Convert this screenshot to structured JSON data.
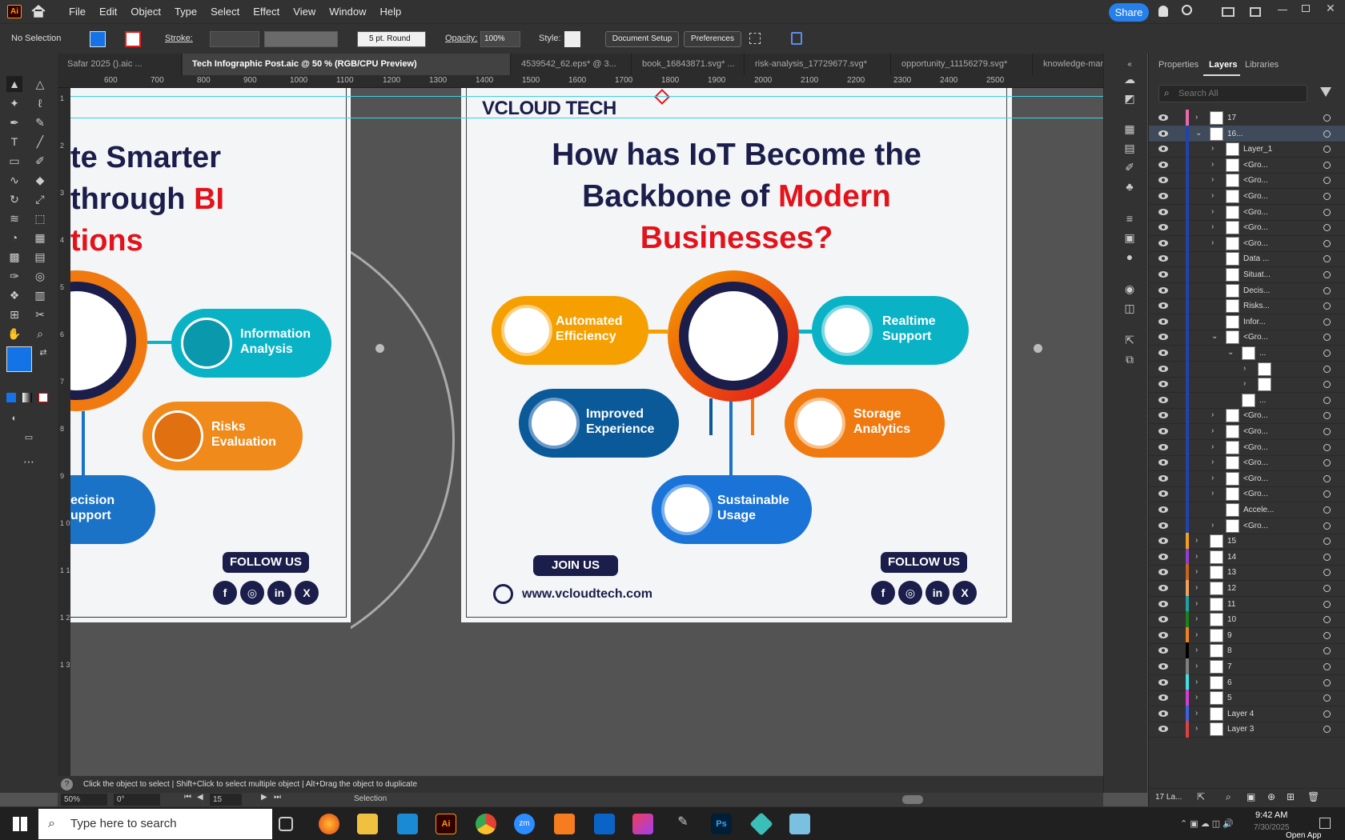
{
  "app": {
    "logo": "Ai",
    "menus": [
      "File",
      "Edit",
      "Object",
      "Type",
      "Select",
      "Effect",
      "View",
      "Window",
      "Help"
    ],
    "share": "Share"
  },
  "control": {
    "selection": "No Selection",
    "stroke_label": "Stroke:",
    "brush": "5 pt. Round",
    "opacity_label": "Opacity:",
    "opacity": "100%",
    "style_label": "Style:",
    "doc_setup": "Document Setup",
    "preferences": "Preferences"
  },
  "tabs": [
    "Safar 2025 ().aic ...",
    "Tech Infographic Post.aic @ 50 % (RGB/CPU Preview)",
    "4539542_62.eps* @ 3...",
    "book_16843871.svg* ...",
    "risk-analysis_17729677.svg*",
    "opportunity_11156279.svg*",
    "knowledge-manage"
  ],
  "ruler": {
    "top": [
      "600",
      "700",
      "800",
      "900",
      "1000",
      "1100",
      "1200",
      "1300",
      "1400",
      "1500",
      "1600",
      "1700",
      "1800",
      "1900",
      "2000",
      "2100",
      "2200",
      "2300",
      "2400",
      "2500"
    ],
    "left": [
      "1",
      "2",
      "3",
      "4",
      "5",
      "6",
      "7",
      "8",
      "9",
      "1 0",
      "1 1",
      "1 2",
      "1 3"
    ]
  },
  "poster_left": {
    "title1": "te Smarter",
    "title2a": "through ",
    "title2b": "BI",
    "title3": "tions",
    "pill1": "Information\nAnalysis",
    "pill2": "Risks\nEvaluation",
    "pill3": "ecision\nupport",
    "follow": "FOLLOW US"
  },
  "poster_right": {
    "logo": "VCLOUD TECH",
    "title1": "How has IoT Become the",
    "title2a": "Backbone of ",
    "title2b": "Modern",
    "title3": "Businesses?",
    "pills": [
      "Automated\nEfficiency",
      "Realtime\nSupport",
      "Improved\nExperience",
      "Storage\nAnalytics",
      "Sustainable\nUsage"
    ],
    "join": "JOIN US",
    "url": "www.vcloudtech.com",
    "follow": "FOLLOW US"
  },
  "social": [
    "f",
    "◎",
    "in",
    "X"
  ],
  "panel": {
    "tabs": [
      "Properties",
      "Layers",
      "Libraries"
    ],
    "search_placeholder": "Search All",
    "layers": [
      {
        "name": "17",
        "indent": 0,
        "color": "#e86aa8",
        "arrow": "›"
      },
      {
        "name": "16...",
        "indent": 0,
        "color": "#2244aa",
        "arrow": "⌄",
        "selected": true
      },
      {
        "name": "Layer_1",
        "indent": 1,
        "color": "#2244aa",
        "arrow": "›"
      },
      {
        "name": "<Gro...",
        "indent": 1,
        "color": "#2244aa",
        "arrow": "›"
      },
      {
        "name": "<Gro...",
        "indent": 1,
        "color": "#2244aa",
        "arrow": "›"
      },
      {
        "name": "<Gro...",
        "indent": 1,
        "color": "#2244aa",
        "arrow": "›"
      },
      {
        "name": "<Gro...",
        "indent": 1,
        "color": "#2244aa",
        "arrow": "›"
      },
      {
        "name": "<Gro...",
        "indent": 1,
        "color": "#2244aa",
        "arrow": "›"
      },
      {
        "name": "<Gro...",
        "indent": 1,
        "color": "#2244aa",
        "arrow": "›"
      },
      {
        "name": "Data ...",
        "indent": 1,
        "color": "#2244aa",
        "arrow": ""
      },
      {
        "name": "Situat...",
        "indent": 1,
        "color": "#2244aa",
        "arrow": ""
      },
      {
        "name": "Decis...",
        "indent": 1,
        "color": "#2244aa",
        "arrow": ""
      },
      {
        "name": "Risks...",
        "indent": 1,
        "color": "#2244aa",
        "arrow": ""
      },
      {
        "name": "Infor...",
        "indent": 1,
        "color": "#2244aa",
        "arrow": ""
      },
      {
        "name": "<Gro...",
        "indent": 1,
        "color": "#2244aa",
        "arrow": "⌄"
      },
      {
        "name": "...",
        "indent": 2,
        "color": "#2244aa",
        "arrow": "⌄"
      },
      {
        "name": "",
        "indent": 3,
        "color": "#2244aa",
        "arrow": "›"
      },
      {
        "name": "",
        "indent": 3,
        "color": "#2244aa",
        "arrow": "›"
      },
      {
        "name": "...",
        "indent": 2,
        "color": "#2244aa",
        "arrow": ""
      },
      {
        "name": "<Gro...",
        "indent": 1,
        "color": "#2244aa",
        "arrow": "›"
      },
      {
        "name": "<Gro...",
        "indent": 1,
        "color": "#2244aa",
        "arrow": "›"
      },
      {
        "name": "<Gro...",
        "indent": 1,
        "color": "#2244aa",
        "arrow": "›"
      },
      {
        "name": "<Gro...",
        "indent": 1,
        "color": "#2244aa",
        "arrow": "›"
      },
      {
        "name": "<Gro...",
        "indent": 1,
        "color": "#2244aa",
        "arrow": "›"
      },
      {
        "name": "<Gro...",
        "indent": 1,
        "color": "#2244aa",
        "arrow": "›"
      },
      {
        "name": "Accele...",
        "indent": 1,
        "color": "#2244aa",
        "arrow": ""
      },
      {
        "name": "<Gro...",
        "indent": 1,
        "color": "#2244aa",
        "arrow": "›"
      },
      {
        "name": "15",
        "indent": 0,
        "color": "#f0a020",
        "arrow": "›"
      },
      {
        "name": "14",
        "indent": 0,
        "color": "#9040d0",
        "arrow": "›"
      },
      {
        "name": "13",
        "indent": 0,
        "color": "#c86420",
        "arrow": "›"
      },
      {
        "name": "12",
        "indent": 0,
        "color": "#f0a060",
        "arrow": "›"
      },
      {
        "name": "11",
        "indent": 0,
        "color": "#20a0a0",
        "arrow": "›"
      },
      {
        "name": "10",
        "indent": 0,
        "color": "#208020",
        "arrow": "›"
      },
      {
        "name": "9",
        "indent": 0,
        "color": "#f08020",
        "arrow": "›"
      },
      {
        "name": "8",
        "indent": 0,
        "color": "#000000",
        "arrow": "›"
      },
      {
        "name": "7",
        "indent": 0,
        "color": "#808080",
        "arrow": "›"
      },
      {
        "name": "6",
        "indent": 0,
        "color": "#40e0e0",
        "arrow": "›"
      },
      {
        "name": "5",
        "indent": 0,
        "color": "#d040d0",
        "arrow": "›"
      },
      {
        "name": "Layer 4",
        "indent": 0,
        "color": "#4060e0",
        "arrow": "›"
      },
      {
        "name": "Layer 3",
        "indent": 0,
        "color": "#e04040",
        "arrow": "›"
      }
    ],
    "footer": "17 La..."
  },
  "status": {
    "hint": "Click the object to select  |  Shift+Click to select multiple object  |  Alt+Drag the object to duplicate",
    "zoom": "50%",
    "rotate": "0°",
    "page": "15",
    "mode": "Selection"
  },
  "taskbar": {
    "search": "Type here to search",
    "time": "9:42 AM",
    "date": "7/30/2025",
    "openapp": "Open App"
  },
  "colors": {
    "navy": "#1b1d4a",
    "red": "#e3121b",
    "orange": "#f5a000",
    "teal": "#0ab2c6",
    "blue": "#0a5a9a",
    "accent": "#2680eb"
  }
}
